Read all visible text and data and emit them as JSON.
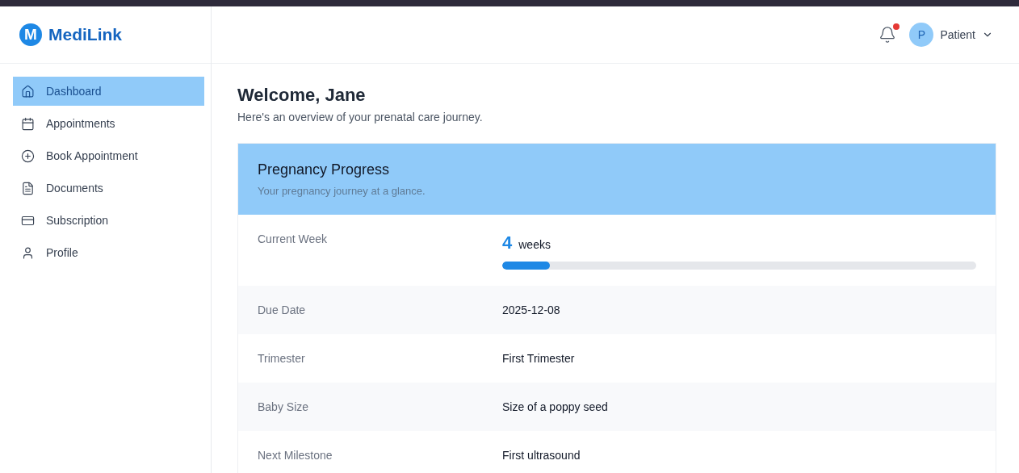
{
  "brand": {
    "logo_letter": "M",
    "name": "MediLink"
  },
  "sidebar": {
    "items": [
      {
        "label": "Dashboard",
        "kind": "home",
        "selected": true
      },
      {
        "label": "Appointments",
        "kind": "calendar",
        "selected": false
      },
      {
        "label": "Book Appointment",
        "kind": "plus",
        "selected": false
      },
      {
        "label": "Documents",
        "kind": "file",
        "selected": false
      },
      {
        "label": "Subscription",
        "kind": "card",
        "selected": false
      },
      {
        "label": "Profile",
        "kind": "user",
        "selected": false
      }
    ]
  },
  "header": {
    "notifications_unread": true,
    "user": {
      "initial": "P",
      "role": "Patient"
    }
  },
  "welcome": {
    "title": "Welcome, Jane",
    "subtitle": "Here's an overview of your prenatal care journey."
  },
  "card": {
    "title": "Pregnancy Progress",
    "subtitle": "Your pregnancy journey at a glance.",
    "rows": [
      {
        "kind": "progress",
        "label": "Current Week",
        "number": "4",
        "unit": "weeks",
        "level": 0.1
      },
      {
        "kind": "text",
        "label": "Due Date",
        "value": "2025-12-08"
      },
      {
        "kind": "text",
        "label": "Trimester",
        "value": "First Trimester"
      },
      {
        "kind": "text",
        "label": "Baby Size",
        "value": "Size of a poppy seed"
      },
      {
        "kind": "text",
        "label": "Next Milestone",
        "value": "First ultrasound"
      }
    ]
  }
}
